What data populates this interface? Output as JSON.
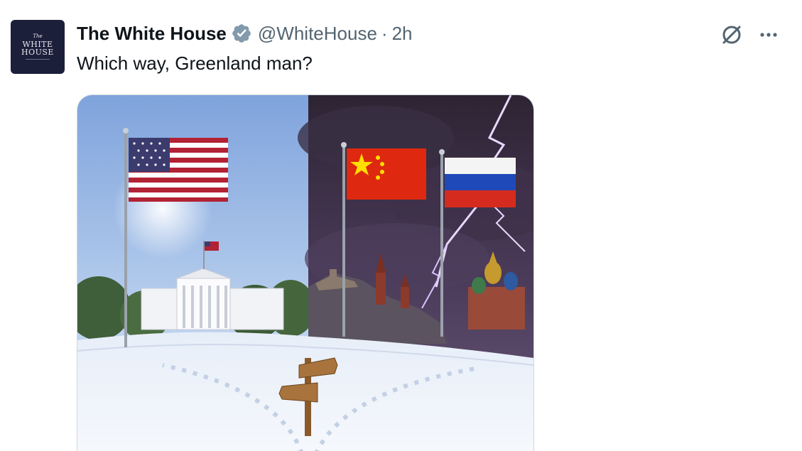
{
  "tweet": {
    "avatar_text_small": "The",
    "avatar_text_line1": "WHITE",
    "avatar_text_line2": "HOUSE",
    "display_name": "The White House",
    "handle": "@WhiteHouse",
    "separator": "·",
    "time": "2h",
    "text": "Which way, Greenland man?"
  },
  "icons": {
    "verified": "verified-badge-icon",
    "grok": "grok-icon",
    "more": "more-icon"
  },
  "colors": {
    "secondary_text": "#536471",
    "verified_badge": "#829aab",
    "avatar_bg": "#1b1f3a"
  }
}
